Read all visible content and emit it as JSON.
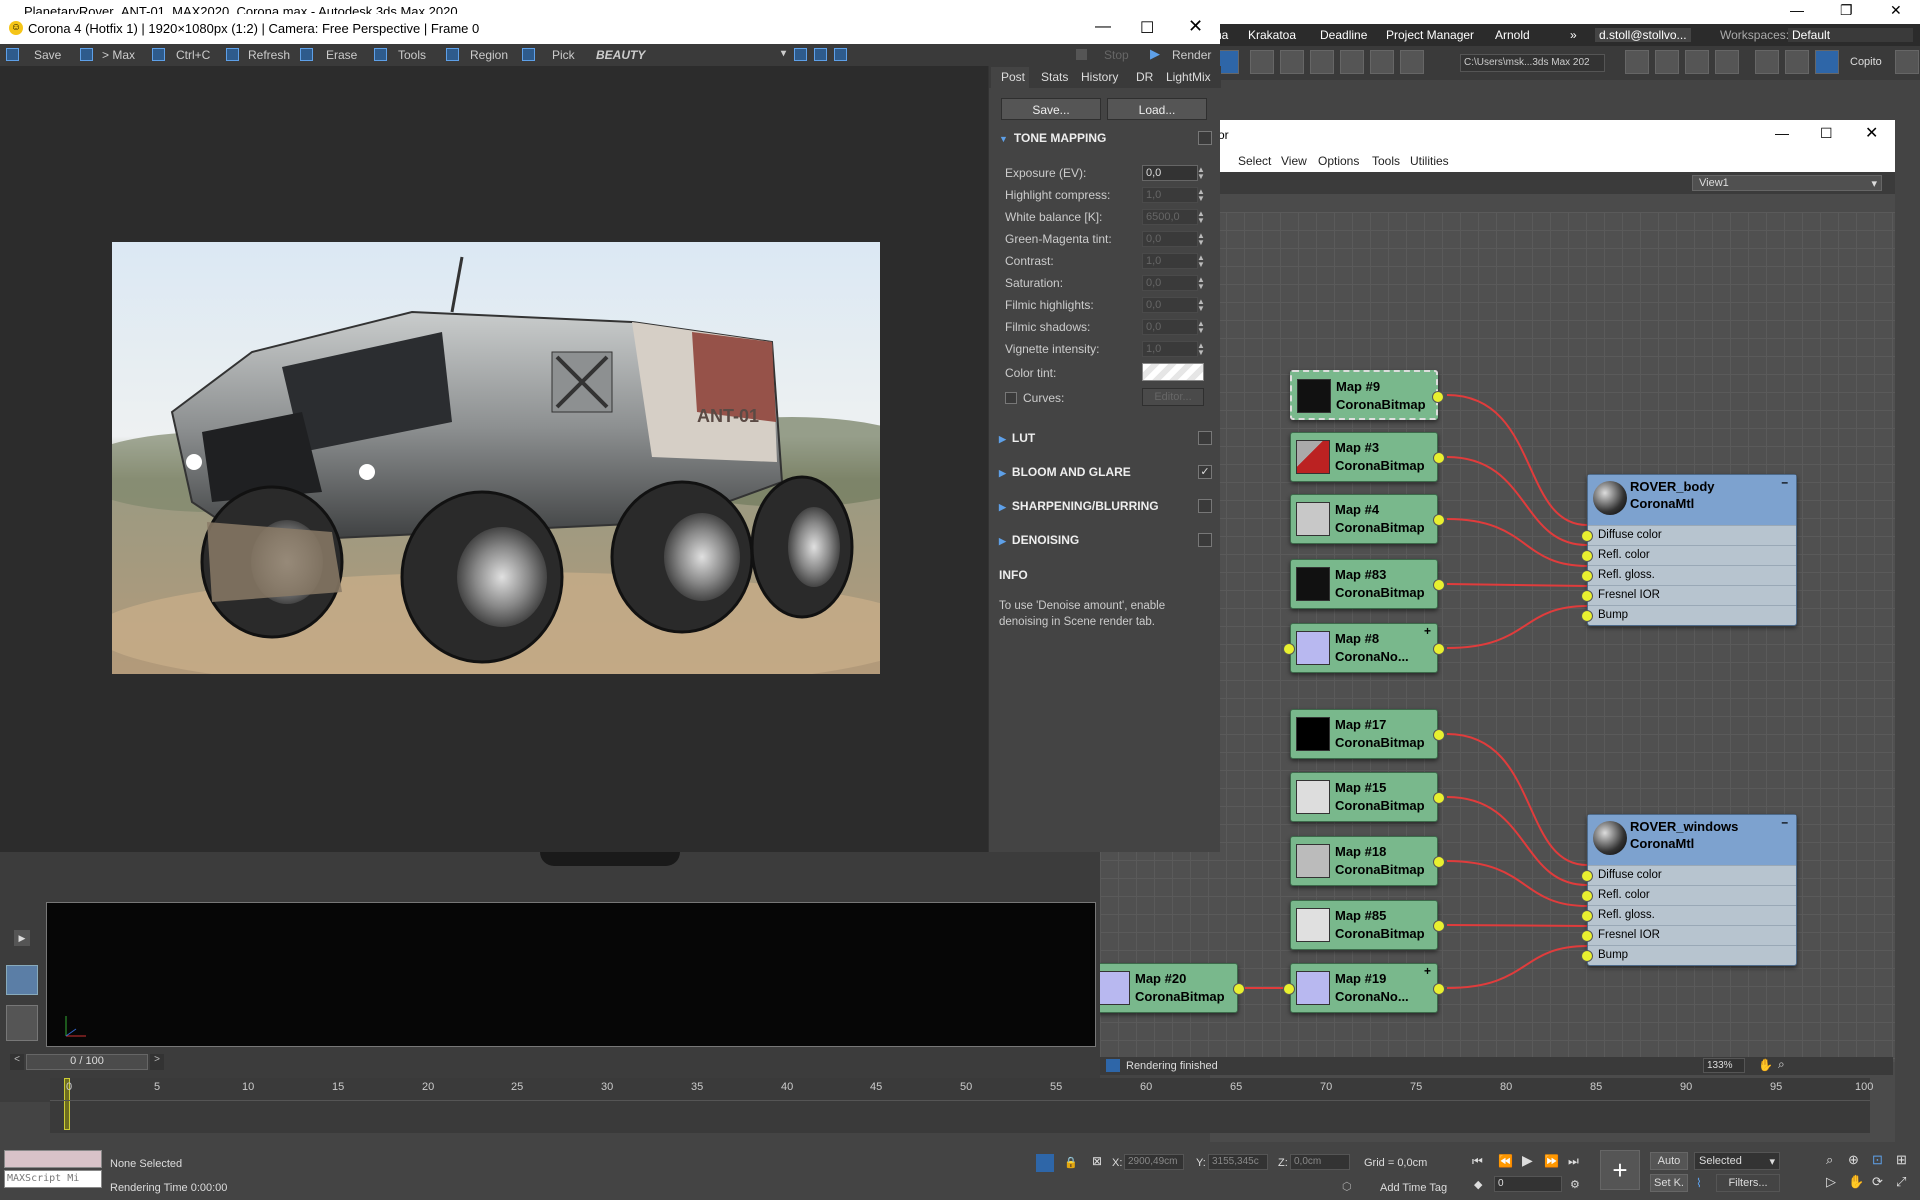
{
  "max_window": {
    "title": "PlanetaryRover_ANT-01_MAX2020_Corona.max - Autodesk 3ds Max 2020",
    "menu": [
      "na",
      "Krakatoa",
      "Deadline",
      "Project Manager",
      "Arnold"
    ],
    "user": "d.stoll@stollvo...",
    "workspaces_label": "Workspaces:",
    "workspace": "Default",
    "path": "C:\\Users\\msk...3ds Max 202",
    "copito": "Copito",
    "win_controls": [
      "—",
      "❐",
      "✕"
    ]
  },
  "sme": {
    "title_fragment": "or",
    "menu": [
      "t",
      "Select",
      "View",
      "Options",
      "Tools",
      "Utilities"
    ],
    "view": "View1",
    "status": "Rendering finished",
    "zoom": "133%",
    "nodes": [
      {
        "id": "Map #9",
        "type": "CoronaBitmap",
        "thumb": "#111"
      },
      {
        "id": "Map #3",
        "type": "CoronaBitmap",
        "thumb": "#a33"
      },
      {
        "id": "Map #4",
        "type": "CoronaBitmap",
        "thumb": "#c8c8c8"
      },
      {
        "id": "Map #83",
        "type": "CoronaBitmap",
        "thumb": "#111"
      },
      {
        "id": "Map #8",
        "type": "CoronaNo...",
        "thumb": "#b8b8f0"
      },
      {
        "id": "Map #17",
        "type": "CoronaBitmap",
        "thumb": "#000"
      },
      {
        "id": "Map #15",
        "type": "CoronaBitmap",
        "thumb": "#ddd"
      },
      {
        "id": "Map #18",
        "type": "CoronaBitmap",
        "thumb": "#bbb"
      },
      {
        "id": "Map #85",
        "type": "CoronaBitmap",
        "thumb": "#e0e0e0"
      },
      {
        "id": "Map #19",
        "type": "CoronaNo...",
        "thumb": "#b8b8f0"
      },
      {
        "id": "Map #20",
        "type": "CoronaBitmap",
        "thumb": "#b8b8f0"
      }
    ],
    "materials": [
      {
        "name": "ROVER_body",
        "type": "CoronaMtl",
        "slots": [
          "Diffuse color",
          "Refl. color",
          "Refl. gloss.",
          "Fresnel IOR",
          "Bump"
        ]
      },
      {
        "name": "ROVER_windows",
        "type": "CoronaMtl",
        "slots": [
          "Diffuse color",
          "Refl. color",
          "Refl. gloss.",
          "Fresnel IOR",
          "Bump"
        ]
      }
    ]
  },
  "vfb": {
    "title": "Corona 4 (Hotfix 1) | 1920×1080px (1:2) | Camera: Free Perspective | Frame 0",
    "toolbar": [
      "Save",
      "> Max",
      "Ctrl+C",
      "Refresh",
      "Erase",
      "Tools",
      "Region",
      "Pick"
    ],
    "channel": "BEAUTY",
    "stop": "Stop",
    "render": "Render",
    "tabs": [
      "Post",
      "Stats",
      "History",
      "DR",
      "LightMix"
    ],
    "save_btn": "Save...",
    "load_btn": "Load...",
    "tone_mapping": "TONE MAPPING",
    "params": [
      {
        "label": "Exposure (EV):",
        "value": "0,0",
        "enabled": true
      },
      {
        "label": "Highlight compress:",
        "value": "1,0",
        "enabled": false
      },
      {
        "label": "White balance [K]:",
        "value": "6500,0",
        "enabled": false
      },
      {
        "label": "Green-Magenta tint:",
        "value": "0,0",
        "enabled": false
      },
      {
        "label": "Contrast:",
        "value": "1,0",
        "enabled": false
      },
      {
        "label": "Saturation:",
        "value": "0,0",
        "enabled": false
      },
      {
        "label": "Filmic highlights:",
        "value": "0,0",
        "enabled": false
      },
      {
        "label": "Filmic shadows:",
        "value": "0,0",
        "enabled": false
      },
      {
        "label": "Vignette intensity:",
        "value": "1,0",
        "enabled": false
      }
    ],
    "color_tint": "Color tint:",
    "curves": "Curves:",
    "editor": "Editor...",
    "sections": [
      {
        "name": "LUT",
        "checked": false
      },
      {
        "name": "BLOOM AND GLARE",
        "checked": true
      },
      {
        "name": "SHARPENING/BLURRING",
        "checked": false
      },
      {
        "name": "DENOISING",
        "checked": false
      }
    ],
    "info_title": "INFO",
    "info_text": "To use 'Denoise amount', enable denoising in Scene render tab.",
    "vehicle_text": "ANT-01"
  },
  "timeline": {
    "frame": "0 / 100",
    "ticks": [
      "0",
      "5",
      "10",
      "15",
      "20",
      "25",
      "30",
      "35",
      "40",
      "45",
      "50",
      "55",
      "60",
      "65",
      "70",
      "75",
      "80",
      "85",
      "90",
      "95",
      "100"
    ]
  },
  "status": {
    "maxscript": "MAXScript Mi",
    "selection": "None Selected",
    "render_time": "Rendering Time  0:00:00",
    "x_label": "X:",
    "x": "2900,49cm",
    "y_label": "Y:",
    "y": "3155,345c",
    "z_label": "Z:",
    "z": "0,0cm",
    "grid": "Grid = 0,0cm",
    "add_time_tag": "Add Time Tag",
    "auto": "Auto",
    "selected": "Selected",
    "set_k": "Set K.",
    "filters": "Filters...",
    "frame_field": "0"
  }
}
